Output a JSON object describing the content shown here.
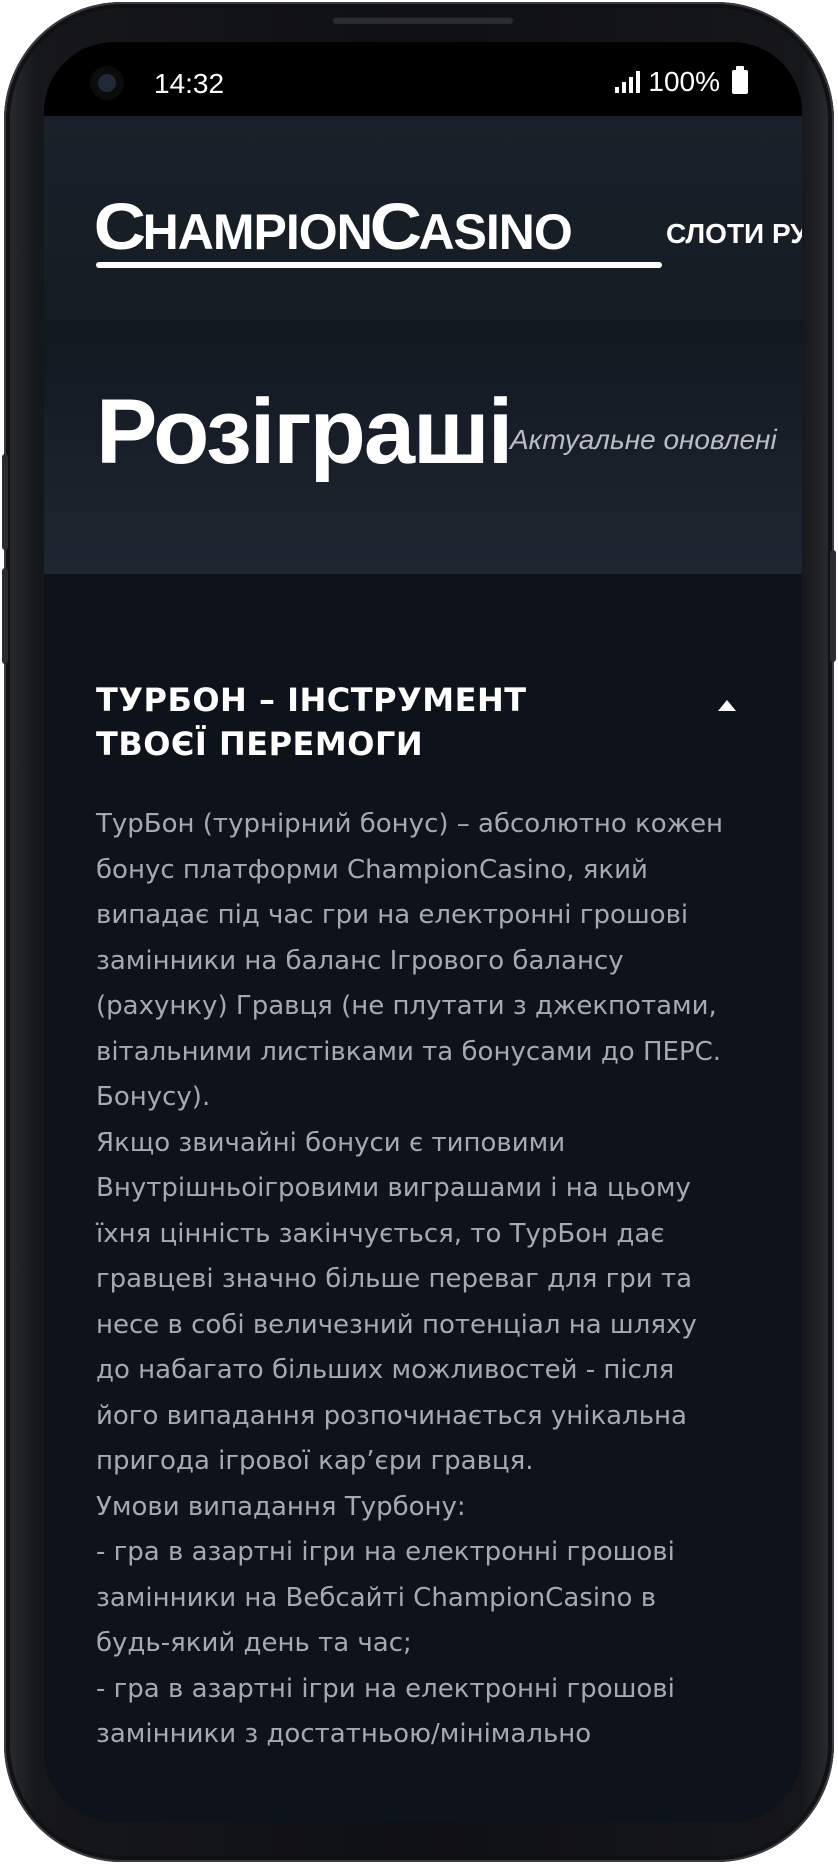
{
  "status_bar": {
    "time": "14:32",
    "battery": "100%"
  },
  "header": {
    "logo_text": "ChampionCasino",
    "logo_parts": [
      "C",
      "HAMPION",
      "C",
      "ASINO"
    ],
    "nav_label": "СЛОТИ РУ"
  },
  "hero": {
    "title": "Розіграші",
    "subtitle": "Актуальне оновлені"
  },
  "accordion": {
    "title_line1": "ТУРБОН – ІНСТРУМЕНТ",
    "title_line2": "ТВОЄЇ ПЕРЕМОГИ",
    "expanded": true,
    "paragraphs": [
      "ТурБон (турнірний бонус) – абсолютно кожен бонус платформи ChampionCasino, який випадає під час гри на електронні грошові замінники на баланс Ігрового балансу (рахунку) Гравця (не плутати з джекпотами, вітальними листівками та бонусами до ПЕРС. Бонусу).",
      "Якщо звичайні бонуси є типовими Внутрішньоігровими виграшами і на цьому їхня цінність закінчується, то ТурБон дає гравцеві значно більше переваг для гри та несе в собі величезний потенціал на шляху до набагато більших можливостей - після його випадання розпочинається унікальна пригода ігрової кар’єри гравця.",
      "Умови випадання Турбону:",
      "- гра в азартні ігри на електронні грошові замінники на Вебсайті ChampionCasino в будь-який день та час;",
      "- гра в азартні ігри на електронні грошові замінники з достатньою/мінімально"
    ]
  },
  "colors": {
    "background": "#0e131b",
    "header_bg": "#1a2029",
    "text_primary": "#ffffff",
    "text_body": "#a4a9b2"
  }
}
